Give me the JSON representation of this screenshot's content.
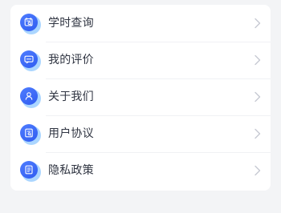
{
  "theme": {
    "accent": "#3164f5",
    "glow": "#8fc8ff",
    "text": "#2f3441",
    "chevron": "#c6c9d2",
    "background": "#f3f4f6",
    "card": "#ffffff"
  },
  "menu": {
    "items": [
      {
        "label": "学时查询",
        "icon": "calendar-search-icon"
      },
      {
        "label": "我的评价",
        "icon": "message-icon"
      },
      {
        "label": "关于我们",
        "icon": "user-icon"
      },
      {
        "label": "用户协议",
        "icon": "document-icon"
      },
      {
        "label": "隐私政策",
        "icon": "policy-icon"
      }
    ]
  }
}
